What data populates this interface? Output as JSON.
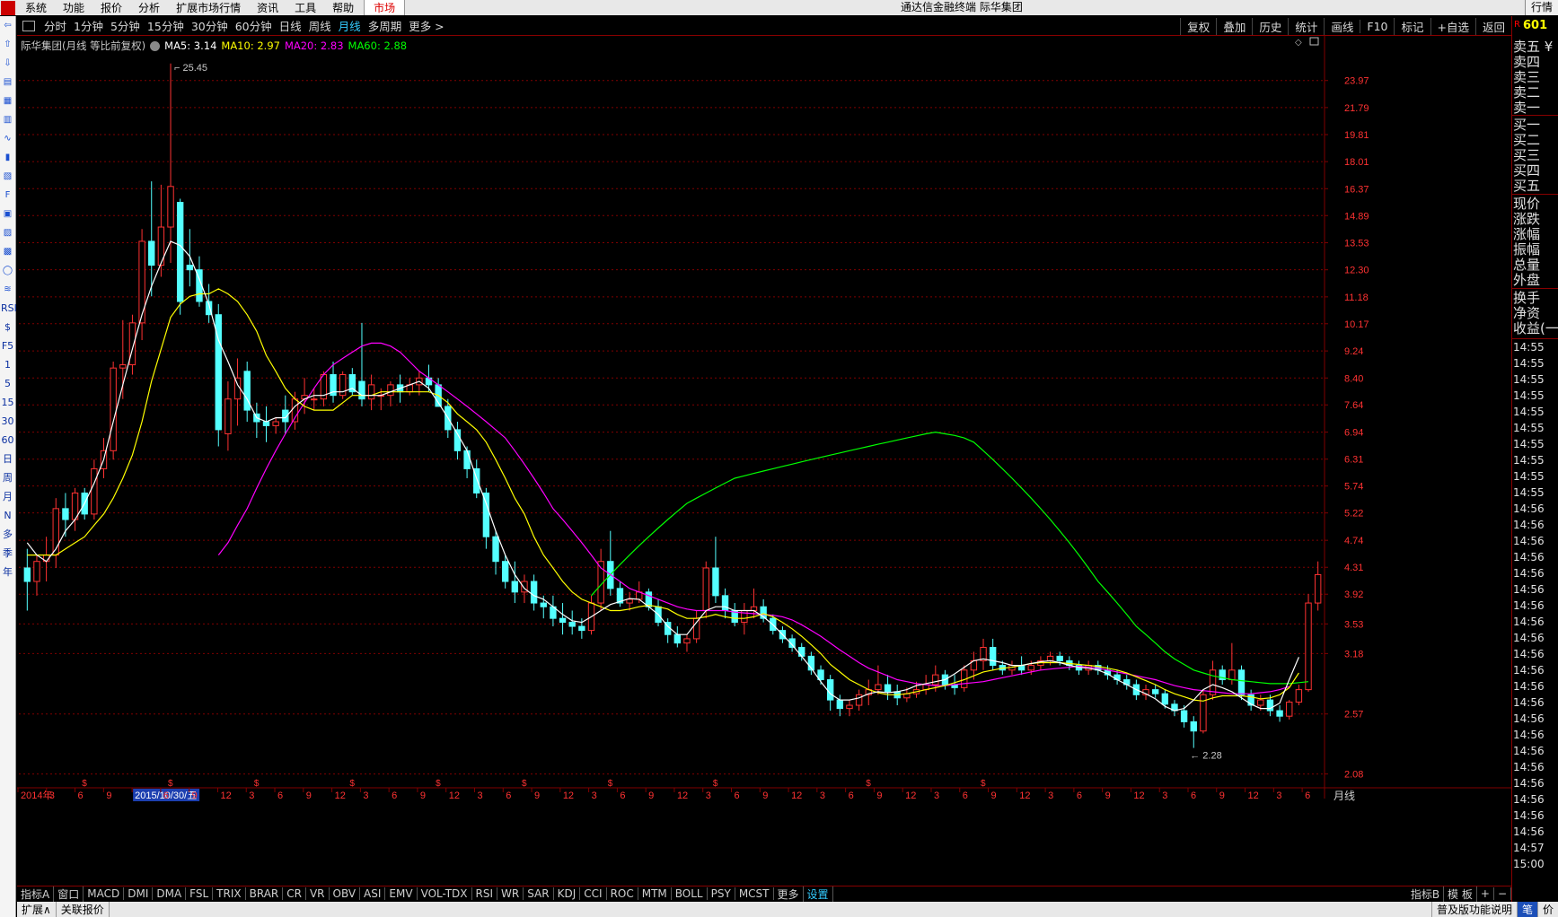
{
  "menubar": {
    "items": [
      "系统",
      "功能",
      "报价",
      "分析",
      "扩展市场行情",
      "资讯",
      "工具",
      "帮助"
    ],
    "market": "市场",
    "title": "通达信金融终端 际华集团",
    "right_tab": "行情"
  },
  "lefttools": {
    "icons": [
      "arrow-left-icon",
      "arrow-up-icon",
      "arrow-down-icon",
      "quote-list-icon",
      "multi-window-icon",
      "grid-icon",
      "line-chart-icon",
      "candle-chart-icon",
      "news-icon",
      "f10-icon",
      "fund-icon",
      "sector-icon",
      "calc-icon",
      "circle-icon",
      "indicator-icon"
    ],
    "text_items": [
      "RSI",
      "$",
      "F5",
      "1",
      "5",
      "15",
      "30",
      "60",
      "日",
      "周",
      "月",
      "N",
      "多",
      "季",
      "年"
    ]
  },
  "periodbar": {
    "periods": [
      "分时",
      "1分钟",
      "5分钟",
      "15分钟",
      "30分钟",
      "60分钟",
      "日线",
      "周线",
      "月线",
      "多周期",
      "更多 >"
    ],
    "active_index": 8,
    "right_tools": [
      "复权",
      "叠加",
      "历史",
      "统计",
      "画线",
      "F10",
      "标记",
      "+自选",
      "返回"
    ]
  },
  "legend": {
    "stock": "际华集团(月线 等比前复权)",
    "ma5": "MA5: 3.14",
    "ma10": "MA10: 2.97",
    "ma20": "MA20: 2.83",
    "ma60": "MA60: 2.88"
  },
  "quote_header": {
    "r": "R",
    "code": "601"
  },
  "quotepanel": {
    "labels": [
      "卖五 ¥",
      "卖四",
      "卖三",
      "卖二",
      "卖一",
      "买一",
      "买二",
      "买三",
      "买四",
      "买五",
      "现价",
      "涨跌",
      "涨幅",
      "振幅",
      "总量",
      "外盘",
      "换手",
      "净资",
      "收益(一)"
    ],
    "times": [
      "14:55",
      "14:55",
      "14:55",
      "14:55",
      "14:55",
      "14:55",
      "14:55",
      "14:55",
      "14:55",
      "14:55",
      "14:56",
      "14:56",
      "14:56",
      "14:56",
      "14:56",
      "14:56",
      "14:56",
      "14:56",
      "14:56",
      "14:56",
      "14:56",
      "14:56",
      "14:56",
      "14:56",
      "14:56",
      "14:56",
      "14:56",
      "14:56",
      "14:56",
      "14:56",
      "14:56",
      "14:57",
      "15:00"
    ]
  },
  "chart_data": {
    "type": "candlestick",
    "y_scale": "log",
    "ylim": [
      2.0,
      26.5
    ],
    "y_ticks": [
      "23.97",
      "21.79",
      "19.81",
      "18.01",
      "16.37",
      "14.89",
      "13.53",
      "12.30",
      "11.18",
      "10.17",
      "9.24",
      "8.40",
      "7.64",
      "6.94",
      "6.31",
      "5.74",
      "5.22",
      "4.74",
      "4.31",
      "3.92",
      "3.53",
      "3.18",
      "2.57",
      "2.08"
    ],
    "high_label": "25.45",
    "low_label": "2.28",
    "x_labels": [
      "2014年",
      "3",
      "6",
      "9",
      "2015/10/30/五",
      "6",
      "9",
      "12",
      "3",
      "6",
      "9",
      "12",
      "3",
      "6",
      "9",
      "12",
      "3",
      "6",
      "9",
      "12",
      "3",
      "6",
      "9",
      "12",
      "3",
      "6",
      "9",
      "12",
      "3",
      "6",
      "9",
      "12",
      "3",
      "6",
      "9",
      "12",
      "3",
      "6",
      "9",
      "12",
      "3",
      "6",
      "9",
      "12",
      "3",
      "6"
    ],
    "period_label": "月线",
    "candles": [
      [
        4.3,
        4.6,
        3.7,
        4.1
      ],
      [
        4.1,
        4.5,
        3.9,
        4.4
      ],
      [
        4.4,
        4.8,
        4.1,
        4.5
      ],
      [
        4.5,
        5.5,
        4.3,
        5.3
      ],
      [
        5.3,
        5.6,
        4.8,
        5.1
      ],
      [
        5.1,
        5.7,
        4.9,
        5.6
      ],
      [
        5.6,
        5.7,
        5.1,
        5.2
      ],
      [
        5.2,
        6.3,
        5.1,
        6.1
      ],
      [
        6.1,
        6.8,
        5.9,
        6.5
      ],
      [
        6.5,
        8.9,
        6.3,
        8.7
      ],
      [
        8.7,
        10.3,
        7.8,
        8.8
      ],
      [
        8.8,
        10.5,
        8.5,
        10.2
      ],
      [
        10.2,
        14.2,
        9.6,
        13.6
      ],
      [
        13.6,
        16.8,
        11.2,
        12.5
      ],
      [
        12.5,
        16.6,
        12.0,
        14.3
      ],
      [
        14.3,
        25.45,
        12.6,
        16.5
      ],
      [
        15.6,
        15.8,
        10.5,
        11.0
      ],
      [
        12.5,
        14.2,
        11.6,
        12.3
      ],
      [
        12.3,
        12.9,
        10.8,
        11.0
      ],
      [
        11.0,
        11.7,
        10.2,
        10.5
      ],
      [
        10.5,
        10.9,
        6.6,
        7.0
      ],
      [
        6.9,
        8.3,
        6.5,
        7.8
      ],
      [
        7.8,
        9.0,
        7.1,
        8.4
      ],
      [
        8.6,
        8.9,
        7.2,
        7.5
      ],
      [
        7.4,
        7.7,
        6.8,
        7.2
      ],
      [
        7.2,
        7.6,
        6.7,
        7.1
      ],
      [
        7.1,
        7.3,
        6.9,
        7.2
      ],
      [
        7.5,
        7.9,
        6.9,
        7.2
      ],
      [
        7.2,
        8.0,
        7.0,
        7.8
      ],
      [
        7.8,
        8.4,
        7.4,
        7.9
      ],
      [
        7.8,
        8.1,
        7.5,
        7.8
      ],
      [
        7.8,
        8.6,
        7.6,
        8.5
      ],
      [
        8.5,
        8.9,
        7.7,
        7.9
      ],
      [
        7.9,
        8.6,
        7.8,
        8.5
      ],
      [
        8.5,
        8.7,
        7.9,
        8.0
      ],
      [
        8.3,
        10.2,
        7.6,
        7.8
      ],
      [
        7.8,
        8.5,
        7.5,
        8.2
      ],
      [
        7.9,
        8.1,
        7.5,
        7.9
      ],
      [
        7.9,
        8.3,
        7.6,
        8.2
      ],
      [
        8.2,
        8.5,
        7.7,
        8.0
      ],
      [
        8.0,
        8.4,
        7.9,
        8.2
      ],
      [
        8.2,
        8.6,
        7.9,
        8.4
      ],
      [
        8.4,
        8.8,
        8.0,
        8.2
      ],
      [
        8.2,
        8.4,
        7.6,
        7.6
      ],
      [
        7.6,
        7.8,
        6.8,
        7.0
      ],
      [
        7.0,
        7.2,
        6.3,
        6.5
      ],
      [
        6.5,
        6.6,
        5.9,
        6.1
      ],
      [
        6.1,
        6.3,
        5.5,
        5.6
      ],
      [
        5.6,
        5.7,
        4.6,
        4.8
      ],
      [
        4.8,
        4.9,
        4.2,
        4.4
      ],
      [
        4.4,
        4.5,
        4.0,
        4.1
      ],
      [
        4.1,
        4.4,
        3.8,
        3.95
      ],
      [
        3.95,
        4.2,
        3.8,
        4.1
      ],
      [
        4.1,
        4.2,
        3.7,
        3.8
      ],
      [
        3.8,
        3.9,
        3.6,
        3.75
      ],
      [
        3.75,
        3.9,
        3.5,
        3.6
      ],
      [
        3.6,
        3.8,
        3.4,
        3.55
      ],
      [
        3.55,
        3.7,
        3.4,
        3.5
      ],
      [
        3.5,
        3.6,
        3.35,
        3.45
      ],
      [
        3.45,
        3.9,
        3.4,
        3.8
      ],
      [
        3.8,
        4.6,
        3.7,
        4.4
      ],
      [
        4.4,
        4.9,
        3.9,
        4.0
      ],
      [
        4.0,
        4.1,
        3.75,
        3.8
      ],
      [
        3.8,
        3.95,
        3.7,
        3.85
      ],
      [
        3.85,
        4.1,
        3.8,
        3.95
      ],
      [
        3.95,
        4.0,
        3.7,
        3.75
      ],
      [
        3.75,
        3.85,
        3.5,
        3.55
      ],
      [
        3.55,
        3.6,
        3.3,
        3.4
      ],
      [
        3.4,
        3.5,
        3.25,
        3.3
      ],
      [
        3.3,
        3.4,
        3.2,
        3.35
      ],
      [
        3.35,
        3.7,
        3.3,
        3.6
      ],
      [
        3.7,
        4.4,
        3.6,
        4.3
      ],
      [
        4.3,
        4.8,
        3.8,
        3.9
      ],
      [
        3.9,
        4.0,
        3.6,
        3.7
      ],
      [
        3.7,
        3.8,
        3.5,
        3.55
      ],
      [
        3.55,
        3.8,
        3.4,
        3.7
      ],
      [
        3.7,
        4.0,
        3.6,
        3.75
      ],
      [
        3.75,
        3.85,
        3.55,
        3.6
      ],
      [
        3.6,
        3.65,
        3.4,
        3.45
      ],
      [
        3.45,
        3.5,
        3.3,
        3.35
      ],
      [
        3.35,
        3.4,
        3.2,
        3.25
      ],
      [
        3.25,
        3.3,
        3.1,
        3.15
      ],
      [
        3.15,
        3.2,
        2.95,
        3.0
      ],
      [
        3.0,
        3.05,
        2.85,
        2.9
      ],
      [
        2.9,
        2.95,
        2.6,
        2.7
      ],
      [
        2.7,
        2.75,
        2.55,
        2.62
      ],
      [
        2.62,
        2.7,
        2.55,
        2.65
      ],
      [
        2.65,
        2.8,
        2.6,
        2.75
      ],
      [
        2.75,
        2.9,
        2.65,
        2.8
      ],
      [
        2.8,
        3.05,
        2.75,
        2.85
      ],
      [
        2.85,
        2.95,
        2.7,
        2.78
      ],
      [
        2.78,
        2.85,
        2.65,
        2.72
      ],
      [
        2.72,
        2.82,
        2.68,
        2.76
      ],
      [
        2.76,
        2.88,
        2.72,
        2.8
      ],
      [
        2.8,
        2.95,
        2.75,
        2.85
      ],
      [
        2.85,
        3.05,
        2.78,
        2.95
      ],
      [
        2.95,
        3.0,
        2.8,
        2.85
      ],
      [
        2.85,
        2.95,
        2.75,
        2.82
      ],
      [
        2.82,
        3.05,
        2.78,
        3.0
      ],
      [
        3.0,
        3.2,
        2.9,
        3.1
      ],
      [
        3.1,
        3.35,
        3.0,
        3.25
      ],
      [
        3.25,
        3.35,
        3.0,
        3.05
      ],
      [
        3.05,
        3.1,
        2.95,
        3.0
      ],
      [
        3.0,
        3.1,
        2.95,
        3.05
      ],
      [
        3.05,
        3.15,
        2.95,
        3.0
      ],
      [
        3.0,
        3.1,
        2.95,
        3.05
      ],
      [
        3.05,
        3.15,
        3.0,
        3.1
      ],
      [
        3.1,
        3.2,
        3.05,
        3.15
      ],
      [
        3.15,
        3.2,
        3.05,
        3.1
      ],
      [
        3.1,
        3.15,
        3.0,
        3.05
      ],
      [
        3.05,
        3.1,
        2.95,
        3.0
      ],
      [
        3.0,
        3.1,
        2.95,
        3.05
      ],
      [
        3.05,
        3.1,
        2.95,
        3.0
      ],
      [
        3.0,
        3.05,
        2.9,
        2.95
      ],
      [
        2.95,
        3.0,
        2.85,
        2.9
      ],
      [
        2.9,
        2.95,
        2.8,
        2.85
      ],
      [
        2.85,
        2.9,
        2.7,
        2.75
      ],
      [
        2.75,
        2.85,
        2.7,
        2.8
      ],
      [
        2.8,
        2.85,
        2.72,
        2.76
      ],
      [
        2.76,
        2.8,
        2.62,
        2.66
      ],
      [
        2.66,
        2.7,
        2.55,
        2.6
      ],
      [
        2.6,
        2.65,
        2.45,
        2.5
      ],
      [
        2.5,
        2.55,
        2.28,
        2.42
      ],
      [
        2.42,
        2.8,
        2.4,
        2.75
      ],
      [
        2.75,
        3.1,
        2.7,
        3.0
      ],
      [
        3.0,
        3.05,
        2.85,
        2.9
      ],
      [
        2.9,
        3.3,
        2.85,
        3.0
      ],
      [
        3.0,
        3.05,
        2.7,
        2.75
      ],
      [
        2.75,
        2.8,
        2.6,
        2.65
      ],
      [
        2.65,
        2.75,
        2.6,
        2.7
      ],
      [
        2.7,
        2.75,
        2.55,
        2.6
      ],
      [
        2.6,
        2.65,
        2.5,
        2.55
      ],
      [
        2.55,
        2.7,
        2.52,
        2.68
      ],
      [
        2.68,
        2.85,
        2.65,
        2.8
      ],
      [
        2.8,
        3.92,
        2.78,
        3.8
      ],
      [
        3.8,
        4.4,
        3.7,
        4.2
      ]
    ],
    "ma5": [
      4.7,
      4.5,
      4.4,
      4.6,
      4.9,
      5.1,
      5.4,
      5.8,
      6.3,
      7.2,
      8.2,
      9.3,
      10.5,
      11.6,
      12.6,
      13.6,
      13.4,
      12.9,
      11.9,
      10.9,
      9.6,
      8.9,
      8.2,
      7.8,
      7.3,
      7.2,
      7.3,
      7.3,
      7.6,
      7.8,
      7.9,
      7.9,
      8.0,
      8.0,
      8.1,
      7.9,
      7.9,
      7.9,
      8.0,
      8.1,
      8.2,
      8.3,
      8.1,
      7.7,
      7.3,
      6.9,
      6.5,
      5.9,
      5.4,
      4.9,
      4.5,
      4.2,
      4.0,
      3.9,
      3.85,
      3.75,
      3.65,
      3.57,
      3.55,
      3.62,
      3.7,
      3.78,
      3.82,
      3.86,
      3.85,
      3.75,
      3.65,
      3.5,
      3.4,
      3.4,
      3.55,
      3.7,
      3.75,
      3.75,
      3.7,
      3.7,
      3.7,
      3.62,
      3.52,
      3.4,
      3.28,
      3.15,
      3.02,
      2.88,
      2.76,
      2.7,
      2.7,
      2.72,
      2.76,
      2.78,
      2.77,
      2.78,
      2.8,
      2.84,
      2.86,
      2.88,
      2.9,
      2.96,
      3.03,
      3.1,
      3.12,
      3.1,
      3.08,
      3.05,
      3.05,
      3.07,
      3.09,
      3.1,
      3.08,
      3.05,
      3.03,
      3.02,
      3.0,
      2.96,
      2.9,
      2.85,
      2.8,
      2.76,
      2.71,
      2.64,
      2.6,
      2.62,
      2.7,
      2.8,
      2.85,
      2.82,
      2.78,
      2.72,
      2.66,
      2.62,
      2.62,
      2.67,
      2.9,
      3.14
    ],
    "ma10": [
      4.5,
      4.5,
      4.5,
      4.5,
      4.6,
      4.7,
      4.8,
      5.0,
      5.2,
      5.5,
      5.9,
      6.4,
      7.2,
      8.3,
      9.3,
      10.4,
      10.9,
      11.2,
      11.3,
      11.3,
      11.5,
      11.3,
      11.0,
      10.5,
      9.9,
      9.1,
      8.6,
      8.1,
      7.8,
      7.6,
      7.5,
      7.5,
      7.5,
      7.7,
      7.9,
      7.9,
      7.9,
      8.0,
      8.0,
      8.0,
      8.0,
      8.0,
      8.0,
      7.9,
      7.7,
      7.4,
      7.2,
      7.0,
      6.7,
      6.3,
      5.9,
      5.5,
      5.2,
      4.8,
      4.5,
      4.3,
      4.1,
      3.95,
      3.85,
      3.8,
      3.75,
      3.7,
      3.7,
      3.72,
      3.75,
      3.77,
      3.75,
      3.72,
      3.65,
      3.6,
      3.6,
      3.62,
      3.65,
      3.62,
      3.6,
      3.6,
      3.62,
      3.66,
      3.62,
      3.55,
      3.47,
      3.38,
      3.28,
      3.18,
      3.06,
      2.98,
      2.9,
      2.85,
      2.8,
      2.77,
      2.75,
      2.75,
      2.76,
      2.78,
      2.8,
      2.82,
      2.84,
      2.87,
      2.9,
      2.94,
      2.98,
      3.0,
      3.02,
      3.03,
      3.05,
      3.07,
      3.08,
      3.08,
      3.08,
      3.07,
      3.06,
      3.05,
      3.04,
      3.02,
      3.0,
      2.97,
      2.93,
      2.89,
      2.85,
      2.8,
      2.76,
      2.73,
      2.7,
      2.69,
      2.72,
      2.74,
      2.74,
      2.74,
      2.73,
      2.71,
      2.72,
      2.75,
      2.82,
      2.97
    ],
    "ma20": [
      null,
      null,
      null,
      null,
      null,
      null,
      null,
      null,
      null,
      null,
      null,
      null,
      null,
      null,
      null,
      null,
      null,
      null,
      null,
      null,
      4.5,
      4.7,
      5.0,
      5.3,
      5.7,
      6.1,
      6.5,
      6.9,
      7.3,
      7.7,
      8.1,
      8.5,
      8.8,
      9.0,
      9.2,
      9.4,
      9.5,
      9.5,
      9.4,
      9.2,
      8.9,
      8.6,
      8.4,
      8.2,
      8.0,
      7.8,
      7.6,
      7.4,
      7.2,
      7.0,
      6.8,
      6.5,
      6.2,
      5.9,
      5.6,
      5.3,
      5.1,
      4.9,
      4.7,
      4.5,
      4.3,
      4.2,
      4.1,
      4.0,
      3.95,
      3.9,
      3.85,
      3.8,
      3.75,
      3.72,
      3.7,
      3.7,
      3.7,
      3.7,
      3.68,
      3.67,
      3.66,
      3.65,
      3.64,
      3.62,
      3.58,
      3.52,
      3.45,
      3.38,
      3.3,
      3.22,
      3.15,
      3.08,
      3.02,
      2.98,
      2.94,
      2.9,
      2.88,
      2.86,
      2.85,
      2.84,
      2.84,
      2.85,
      2.86,
      2.87,
      2.88,
      2.9,
      2.92,
      2.94,
      2.96,
      2.98,
      3.0,
      3.01,
      3.02,
      3.03,
      3.04,
      3.03,
      3.02,
      3.0,
      2.98,
      2.96,
      2.94,
      2.92,
      2.9,
      2.87,
      2.84,
      2.82,
      2.8,
      2.79,
      2.78,
      2.77,
      2.76,
      2.76,
      2.76,
      2.77,
      2.78,
      2.8,
      2.83
    ],
    "ma60": [
      null,
      null,
      null,
      null,
      null,
      null,
      null,
      null,
      null,
      null,
      null,
      null,
      null,
      null,
      null,
      null,
      null,
      null,
      null,
      null,
      null,
      null,
      null,
      null,
      null,
      null,
      null,
      null,
      null,
      null,
      null,
      null,
      null,
      null,
      null,
      null,
      null,
      null,
      null,
      null,
      null,
      null,
      null,
      null,
      null,
      null,
      null,
      null,
      null,
      null,
      null,
      null,
      null,
      null,
      null,
      null,
      null,
      null,
      null,
      3.9,
      4.05,
      4.2,
      4.35,
      4.5,
      4.65,
      4.8,
      4.95,
      5.1,
      5.25,
      5.4,
      5.5,
      5.6,
      5.7,
      5.8,
      5.9,
      5.95,
      6.0,
      6.05,
      6.1,
      6.15,
      6.2,
      6.25,
      6.3,
      6.35,
      6.4,
      6.45,
      6.5,
      6.55,
      6.6,
      6.65,
      6.7,
      6.75,
      6.8,
      6.85,
      6.9,
      6.94,
      6.9,
      6.86,
      6.8,
      6.7,
      6.5,
      6.3,
      6.1,
      5.9,
      5.7,
      5.5,
      5.3,
      5.1,
      4.9,
      4.7,
      4.5,
      4.3,
      4.1,
      3.95,
      3.8,
      3.65,
      3.5,
      3.4,
      3.3,
      3.2,
      3.12,
      3.06,
      3.0,
      2.97,
      2.94,
      2.92,
      2.9,
      2.89,
      2.88,
      2.87,
      2.86,
      2.86,
      2.86,
      2.87,
      2.88
    ]
  },
  "indbar": {
    "items": [
      "指标A",
      "窗口",
      "MACD",
      "DMI",
      "DMA",
      "FSL",
      "TRIX",
      "BRAR",
      "CR",
      "VR",
      "OBV",
      "ASI",
      "EMV",
      "VOL-TDX",
      "RSI",
      "WR",
      "SAR",
      "KDJ",
      "CCI",
      "ROC",
      "MTM",
      "BOLL",
      "PSY",
      "MCST",
      "更多",
      "设置"
    ],
    "active_index": 25,
    "right_items": [
      "指标B",
      "模 板",
      "+",
      "−"
    ]
  },
  "statusbar": {
    "left": [
      "扩展∧",
      "关联报价"
    ],
    "right": [
      "普及版功能说明",
      "笔",
      "价"
    ]
  },
  "colors": {
    "up": "#ff3232",
    "down": "#54ffff",
    "grid": "#800000",
    "axis_text": "#ff3232"
  }
}
